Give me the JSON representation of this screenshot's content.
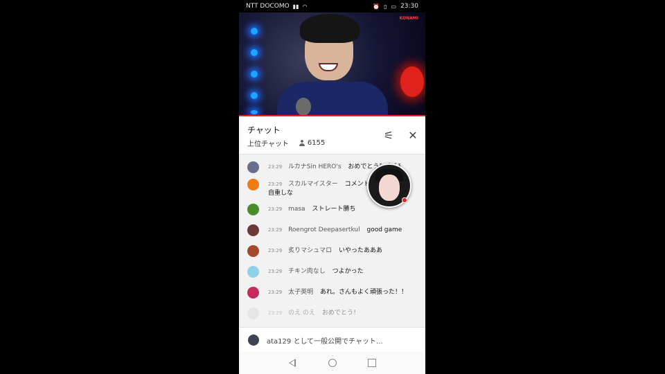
{
  "status_bar": {
    "carrier": "NTT DOCOMO",
    "time": "23:30",
    "battery_icon": "battery-icon",
    "wifi_icon": "wifi-icon"
  },
  "video": {
    "brand_text": "KONAMI"
  },
  "chat": {
    "title": "チャット",
    "mode": "上位チャット",
    "viewer_count": "6155",
    "filter_icon": "tune-icon",
    "close_icon": "close-icon",
    "messages": [
      {
        "time": "23:29",
        "author": "ルカナSin HERO's",
        "text": "おめでとうﾁｬｿﾞﾊﾞﾁ",
        "avatar_color": "#6b6d8f",
        "continuation": ""
      },
      {
        "time": "23:29",
        "author": "スカルマイスター",
        "text": "コメント",
        "avatar_color": "#f07a14",
        "continuation": "自重しな"
      },
      {
        "time": "23:29",
        "author": "masa",
        "text": "ストレート勝ち",
        "avatar_color": "#4a8b2c",
        "continuation": ""
      },
      {
        "time": "23:29",
        "author": "Roengrot Deepasertkul",
        "text": "good game",
        "avatar_color": "#6a3a3a",
        "continuation": ""
      },
      {
        "time": "23:29",
        "author": "炙りマシュマロ",
        "text": "いやったあああ",
        "avatar_color": "#a44a2a",
        "continuation": ""
      },
      {
        "time": "23:29",
        "author": "チキン肉なし",
        "text": "つよかった",
        "avatar_color": "#8fd0ea",
        "continuation": ""
      },
      {
        "time": "23:29",
        "author": "太子英明",
        "text": "あれ。さんもよく頑張った！！",
        "avatar_color": "#c42a5a",
        "continuation": ""
      },
      {
        "time": "23:29",
        "author": "のえ のえ",
        "text": "おめでとう！",
        "avatar_color": "#d8d8d8",
        "continuation": ""
      }
    ]
  },
  "input": {
    "placeholder": "ata129 として一般公開でチャット..."
  },
  "colors": {
    "accent_red": "#e0241f",
    "background": "#000000"
  }
}
